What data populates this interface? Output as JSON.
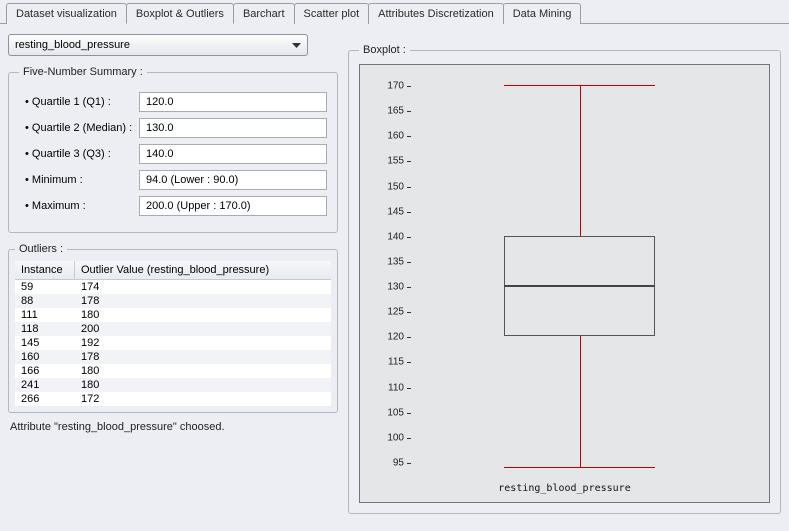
{
  "tabs": [
    {
      "label": "Dataset visualization"
    },
    {
      "label": "Boxplot & Outliers"
    },
    {
      "label": "Barchart"
    },
    {
      "label": "Scatter plot"
    },
    {
      "label": "Attributes Discretization"
    },
    {
      "label": "Data Mining"
    }
  ],
  "active_tab": 1,
  "attribute_select": {
    "value": "resting_blood_pressure"
  },
  "summary": {
    "title": "Five-Number Summary :",
    "rows": [
      {
        "label": "Quartile 1 (Q1) :",
        "value": "120.0"
      },
      {
        "label": "Quartile 2 (Median) :",
        "value": "130.0"
      },
      {
        "label": "Quartile 3 (Q3) :",
        "value": "140.0"
      },
      {
        "label": "Minimum :",
        "value": "94.0   (Lower :  90.0)"
      },
      {
        "label": "Maximum :",
        "value": "200.0   (Upper :  170.0)"
      }
    ]
  },
  "outliers": {
    "title": "Outliers :",
    "columns": [
      "Instance",
      "Outlier Value (resting_blood_pressure)"
    ],
    "rows": [
      {
        "instance": "59",
        "value": "174"
      },
      {
        "instance": "88",
        "value": "178"
      },
      {
        "instance": "111",
        "value": "180"
      },
      {
        "instance": "118",
        "value": "200"
      },
      {
        "instance": "145",
        "value": "192"
      },
      {
        "instance": "160",
        "value": "178"
      },
      {
        "instance": "166",
        "value": "180"
      },
      {
        "instance": "241",
        "value": "180"
      },
      {
        "instance": "266",
        "value": "172"
      }
    ]
  },
  "boxplot_title": "Boxplot :",
  "status": "Attribute \"resting_blood_pressure\" choosed.",
  "chart_data": {
    "type": "boxplot",
    "title": "",
    "xlabel": "resting_blood_pressure",
    "ylabel": "",
    "ylim": [
      93,
      172
    ],
    "yticks": [
      95,
      100,
      105,
      110,
      115,
      120,
      125,
      130,
      135,
      140,
      145,
      150,
      155,
      160,
      165,
      170
    ],
    "q1": 120,
    "median": 130,
    "q3": 140,
    "lower_whisker": 94,
    "upper_whisker": 170
  }
}
